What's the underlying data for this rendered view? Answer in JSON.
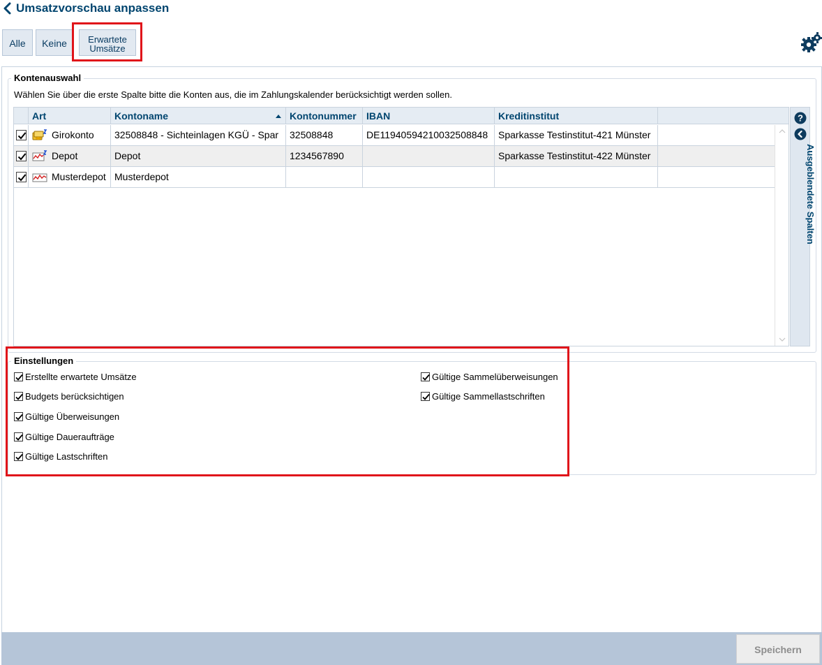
{
  "header": {
    "title": "Umsatzvorschau anpassen"
  },
  "toolbar": {
    "alle_label": "Alle",
    "keine_label": "Keine",
    "erwartete_line1": "Erwartete",
    "erwartete_line2": "Umsätze"
  },
  "kontenauswahl": {
    "legend": "Kontenauswahl",
    "instruction": "Wählen Sie über die erste Spalte bitte die Konten aus, die im Zahlungskalender berücksichtigt werden sollen.",
    "columns": {
      "art": "Art",
      "kontoname": "Kontoname",
      "kontonummer": "Kontonummer",
      "iban": "IBAN",
      "kreditinstitut": "Kreditinstitut"
    },
    "rows": [
      {
        "checked": true,
        "icon": "girokonto-icon",
        "art": "Girokonto",
        "kontoname": "32508848 - Sichteinlagen KGÜ - Spar",
        "kontonummer": "32508848",
        "iban": "DE11940594210032508848",
        "kreditinstitut": "Sparkasse Testinstitut-421 Münster"
      },
      {
        "checked": true,
        "icon": "depot-icon",
        "art": "Depot",
        "kontoname": "Depot",
        "kontonummer": "1234567890",
        "iban": "",
        "kreditinstitut": "Sparkasse Testinstitut-422 Münster"
      },
      {
        "checked": true,
        "icon": "musterdepot-icon",
        "art": "Musterdepot",
        "kontoname": "Musterdepot",
        "kontonummer": "",
        "iban": "",
        "kreditinstitut": ""
      }
    ],
    "side_panel_label": "Ausgeblendete Spalten"
  },
  "einstellungen": {
    "legend": "Einstellungen",
    "left": [
      {
        "label": "Erstellte erwartete Umsätze",
        "checked": true
      },
      {
        "label": "Budgets berücksichtigen",
        "checked": true
      },
      {
        "label": "Gültige Überweisungen",
        "checked": true
      },
      {
        "label": "Gültige Daueraufträge",
        "checked": true
      },
      {
        "label": "Gültige Lastschriften",
        "checked": true
      }
    ],
    "right": [
      {
        "label": "Gültige Sammelüberweisungen",
        "checked": true
      },
      {
        "label": "Gültige Sammellastschriften",
        "checked": true
      }
    ]
  },
  "footer": {
    "save_label": "Speichern"
  },
  "colors": {
    "title": "#00456f",
    "highlight": "#e0141a",
    "footer": "#b5c5d8"
  }
}
